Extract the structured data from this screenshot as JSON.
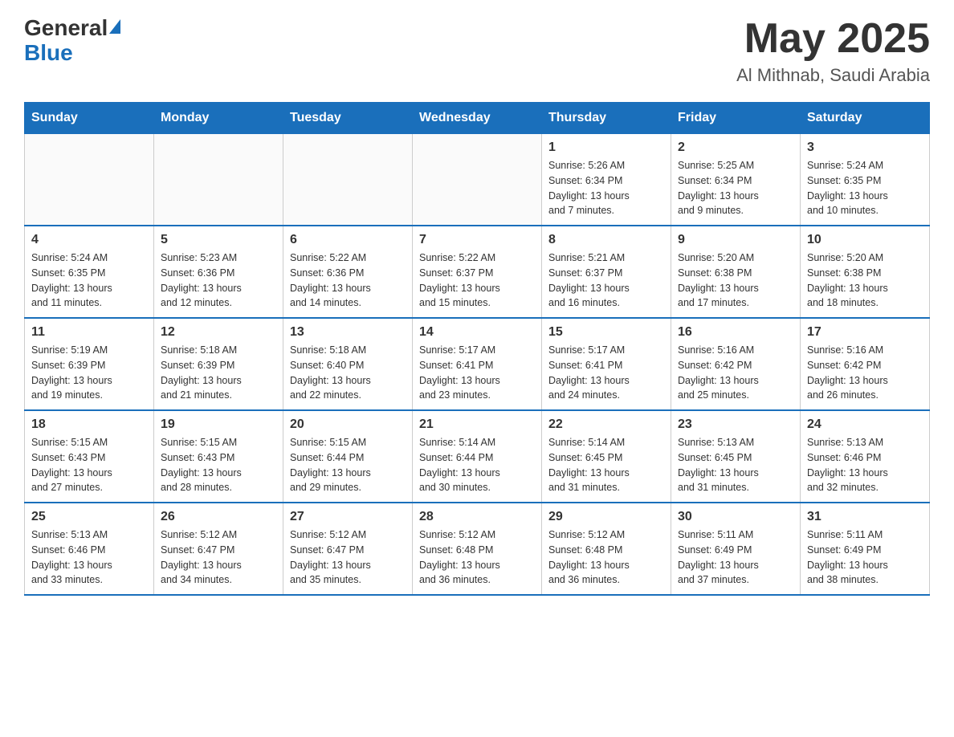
{
  "header": {
    "logo_general": "General",
    "logo_blue": "Blue",
    "month_title": "May 2025",
    "location": "Al Mithnab, Saudi Arabia"
  },
  "weekdays": [
    "Sunday",
    "Monday",
    "Tuesday",
    "Wednesday",
    "Thursday",
    "Friday",
    "Saturday"
  ],
  "weeks": [
    [
      {
        "day": "",
        "info": ""
      },
      {
        "day": "",
        "info": ""
      },
      {
        "day": "",
        "info": ""
      },
      {
        "day": "",
        "info": ""
      },
      {
        "day": "1",
        "info": "Sunrise: 5:26 AM\nSunset: 6:34 PM\nDaylight: 13 hours\nand 7 minutes."
      },
      {
        "day": "2",
        "info": "Sunrise: 5:25 AM\nSunset: 6:34 PM\nDaylight: 13 hours\nand 9 minutes."
      },
      {
        "day": "3",
        "info": "Sunrise: 5:24 AM\nSunset: 6:35 PM\nDaylight: 13 hours\nand 10 minutes."
      }
    ],
    [
      {
        "day": "4",
        "info": "Sunrise: 5:24 AM\nSunset: 6:35 PM\nDaylight: 13 hours\nand 11 minutes."
      },
      {
        "day": "5",
        "info": "Sunrise: 5:23 AM\nSunset: 6:36 PM\nDaylight: 13 hours\nand 12 minutes."
      },
      {
        "day": "6",
        "info": "Sunrise: 5:22 AM\nSunset: 6:36 PM\nDaylight: 13 hours\nand 14 minutes."
      },
      {
        "day": "7",
        "info": "Sunrise: 5:22 AM\nSunset: 6:37 PM\nDaylight: 13 hours\nand 15 minutes."
      },
      {
        "day": "8",
        "info": "Sunrise: 5:21 AM\nSunset: 6:37 PM\nDaylight: 13 hours\nand 16 minutes."
      },
      {
        "day": "9",
        "info": "Sunrise: 5:20 AM\nSunset: 6:38 PM\nDaylight: 13 hours\nand 17 minutes."
      },
      {
        "day": "10",
        "info": "Sunrise: 5:20 AM\nSunset: 6:38 PM\nDaylight: 13 hours\nand 18 minutes."
      }
    ],
    [
      {
        "day": "11",
        "info": "Sunrise: 5:19 AM\nSunset: 6:39 PM\nDaylight: 13 hours\nand 19 minutes."
      },
      {
        "day": "12",
        "info": "Sunrise: 5:18 AM\nSunset: 6:39 PM\nDaylight: 13 hours\nand 21 minutes."
      },
      {
        "day": "13",
        "info": "Sunrise: 5:18 AM\nSunset: 6:40 PM\nDaylight: 13 hours\nand 22 minutes."
      },
      {
        "day": "14",
        "info": "Sunrise: 5:17 AM\nSunset: 6:41 PM\nDaylight: 13 hours\nand 23 minutes."
      },
      {
        "day": "15",
        "info": "Sunrise: 5:17 AM\nSunset: 6:41 PM\nDaylight: 13 hours\nand 24 minutes."
      },
      {
        "day": "16",
        "info": "Sunrise: 5:16 AM\nSunset: 6:42 PM\nDaylight: 13 hours\nand 25 minutes."
      },
      {
        "day": "17",
        "info": "Sunrise: 5:16 AM\nSunset: 6:42 PM\nDaylight: 13 hours\nand 26 minutes."
      }
    ],
    [
      {
        "day": "18",
        "info": "Sunrise: 5:15 AM\nSunset: 6:43 PM\nDaylight: 13 hours\nand 27 minutes."
      },
      {
        "day": "19",
        "info": "Sunrise: 5:15 AM\nSunset: 6:43 PM\nDaylight: 13 hours\nand 28 minutes."
      },
      {
        "day": "20",
        "info": "Sunrise: 5:15 AM\nSunset: 6:44 PM\nDaylight: 13 hours\nand 29 minutes."
      },
      {
        "day": "21",
        "info": "Sunrise: 5:14 AM\nSunset: 6:44 PM\nDaylight: 13 hours\nand 30 minutes."
      },
      {
        "day": "22",
        "info": "Sunrise: 5:14 AM\nSunset: 6:45 PM\nDaylight: 13 hours\nand 31 minutes."
      },
      {
        "day": "23",
        "info": "Sunrise: 5:13 AM\nSunset: 6:45 PM\nDaylight: 13 hours\nand 31 minutes."
      },
      {
        "day": "24",
        "info": "Sunrise: 5:13 AM\nSunset: 6:46 PM\nDaylight: 13 hours\nand 32 minutes."
      }
    ],
    [
      {
        "day": "25",
        "info": "Sunrise: 5:13 AM\nSunset: 6:46 PM\nDaylight: 13 hours\nand 33 minutes."
      },
      {
        "day": "26",
        "info": "Sunrise: 5:12 AM\nSunset: 6:47 PM\nDaylight: 13 hours\nand 34 minutes."
      },
      {
        "day": "27",
        "info": "Sunrise: 5:12 AM\nSunset: 6:47 PM\nDaylight: 13 hours\nand 35 minutes."
      },
      {
        "day": "28",
        "info": "Sunrise: 5:12 AM\nSunset: 6:48 PM\nDaylight: 13 hours\nand 36 minutes."
      },
      {
        "day": "29",
        "info": "Sunrise: 5:12 AM\nSunset: 6:48 PM\nDaylight: 13 hours\nand 36 minutes."
      },
      {
        "day": "30",
        "info": "Sunrise: 5:11 AM\nSunset: 6:49 PM\nDaylight: 13 hours\nand 37 minutes."
      },
      {
        "day": "31",
        "info": "Sunrise: 5:11 AM\nSunset: 6:49 PM\nDaylight: 13 hours\nand 38 minutes."
      }
    ]
  ]
}
